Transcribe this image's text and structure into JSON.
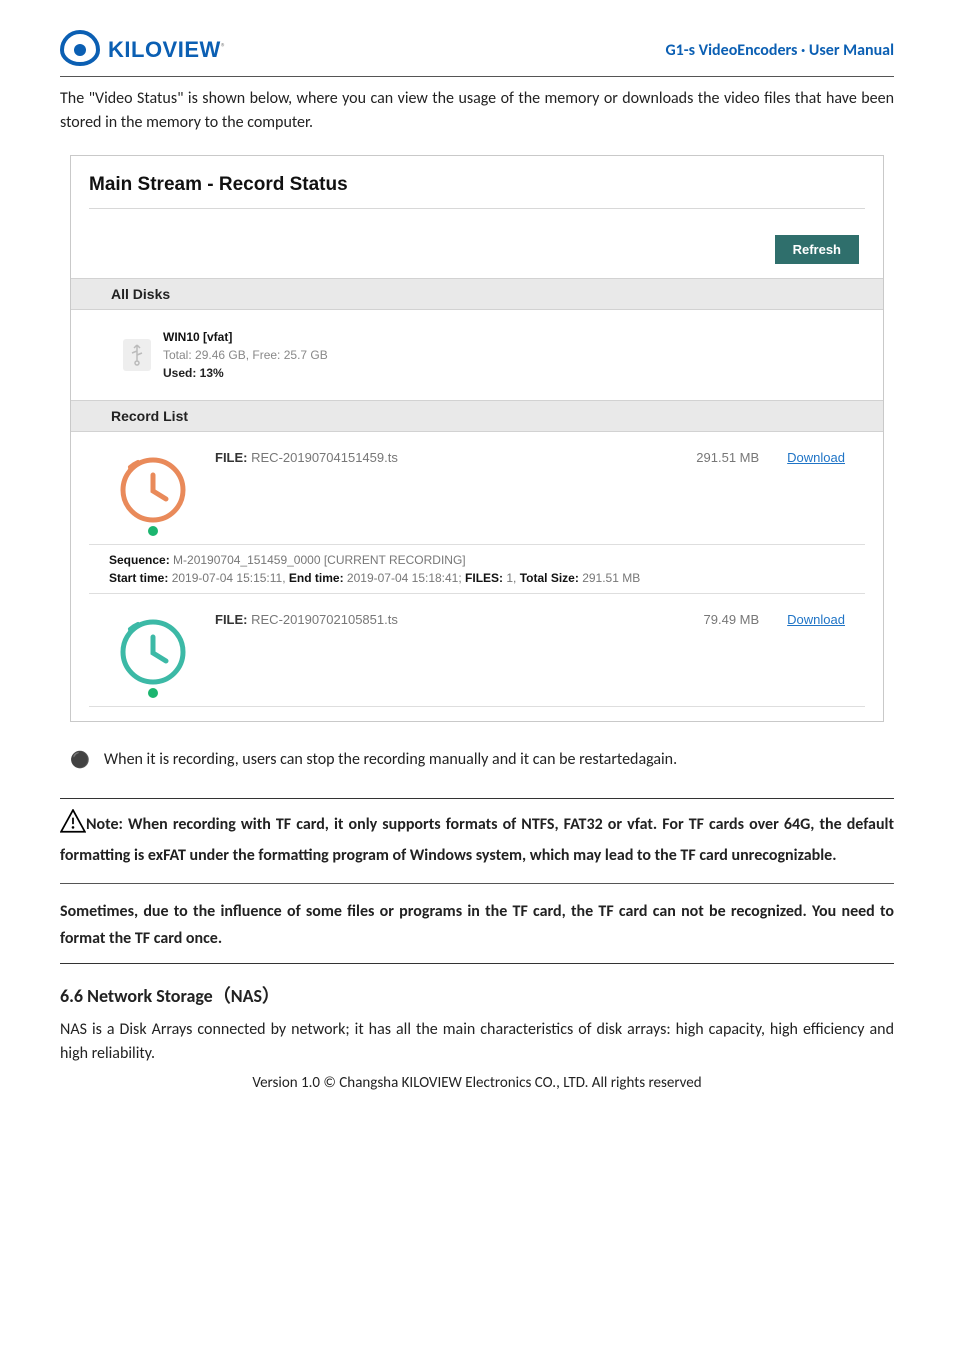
{
  "brand": "KILOVIEW",
  "doc_title": "G1-s VideoEncoders · User Manual",
  "intro_para": "The \"Video Status\" is shown below, where you can view the usage of the memory or downloads the video files that have been stored in the memory to the computer.",
  "screenshot": {
    "title": "Main Stream - Record Status",
    "refresh_btn": "Refresh",
    "all_disks_hdr": "All Disks",
    "disk": {
      "name": "WIN10 [vfat]",
      "stats": "Total: 29.46 GB, Free: 25.7 GB",
      "used": "Used: 13%"
    },
    "record_list_hdr": "Record List",
    "rec1": {
      "file_label": "FILE:",
      "file_name": "REC-20190704151459.ts",
      "size": "291.51 MB",
      "download": "Download",
      "seq_label": "Sequence:",
      "seq_val": "M-20190704_151459_0000 [CURRENT RECORDING]",
      "line2": "Start time: 2019-07-04 15:15:11, End time: 2019-07-04 15:18:41; FILES: 1, Total Size: 291.51 MB"
    },
    "rec2": {
      "file_label": "FILE:",
      "file_name": "REC-20190702105851.ts",
      "size": "79.49 MB",
      "download": "Download"
    }
  },
  "bullet": "When it is recording, users can stop the recording manually and it can be restartedagain.",
  "note1": "Note: When recording with TF card, it only supports formats of NTFS, FAT32 or vfat. For TF cards over 64G, the default formatting is exFAT under the formatting program of Windows system, which may lead to the TF card unrecognizable.",
  "note2": "Sometimes, due to the influence of some files or programs in the TF card, the TF card can not be recognized. You need to format the TF card once.",
  "sect_heading": "6.6 Network Storage（NAS）",
  "nas_para": "NAS is a Disk Arrays connected by network; it has all the main characteristics of disk arrays: high capacity, high efficiency and high reliability.",
  "footer": "Version 1.0 © Changsha KILOVIEW Electronics CO., LTD. All rights reserved"
}
